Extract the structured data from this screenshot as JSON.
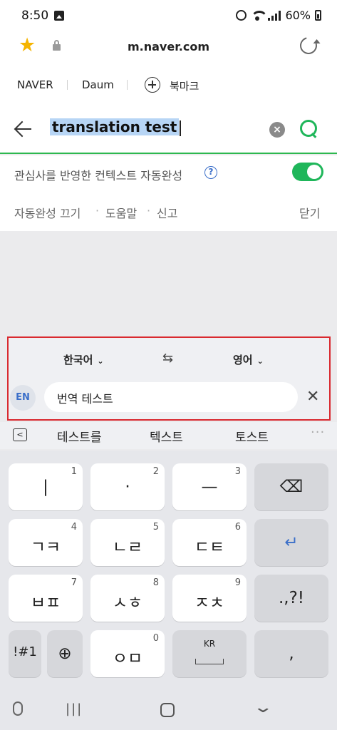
{
  "status_bar": {
    "time": "8:50",
    "battery": "60%"
  },
  "browser": {
    "url": "m.naver.com"
  },
  "bookmarks": {
    "items": [
      "NAVER",
      "Daum",
      "북마크"
    ]
  },
  "search": {
    "query": "translation test"
  },
  "autocomplete": {
    "context_label": "관심사를 반영한 컨텍스트 자동완성",
    "help_glyph": "?",
    "toggle_on": true,
    "links": [
      "자동완성 끄기",
      "도움말",
      "신고"
    ],
    "close_label": "닫기"
  },
  "translator": {
    "source_lang": "한국어",
    "target_lang": "영어",
    "swap_glyph": "⇆",
    "input_badge": "EN",
    "input_text": "번역 테스트",
    "clear_glyph": "✕"
  },
  "suggestions": {
    "items": [
      "테스트를",
      "텍스트",
      "토스트"
    ],
    "collapse_glyph": "<",
    "more_glyph": "···"
  },
  "keyboard": {
    "keys": [
      {
        "label": "|",
        "num": "1"
      },
      {
        "label": "·",
        "num": "2"
      },
      {
        "label": "—",
        "num": "3"
      },
      {
        "label": "⌫",
        "num": ""
      },
      {
        "label": "ㄱㅋ",
        "num": "4"
      },
      {
        "label": "ㄴㄹ",
        "num": "5"
      },
      {
        "label": "ㄷㅌ",
        "num": "6"
      },
      {
        "label": "↵",
        "num": ""
      },
      {
        "label": "ㅂㅍ",
        "num": "7"
      },
      {
        "label": "ㅅㅎ",
        "num": "8"
      },
      {
        "label": "ㅈㅊ",
        "num": "9"
      },
      {
        "label": ".,?!",
        "num": ""
      },
      {
        "label": "!#1",
        "num": ""
      },
      {
        "label": "⊕",
        "num": ""
      },
      {
        "label": "ㅇㅁ",
        "num": "0"
      },
      {
        "label": "KR",
        "num": ""
      },
      {
        "label": ",",
        "num": ""
      }
    ]
  },
  "colors": {
    "naver_green": "#1fb65a",
    "accent_blue": "#3b6fc9",
    "highlight_red": "#d9292f"
  }
}
